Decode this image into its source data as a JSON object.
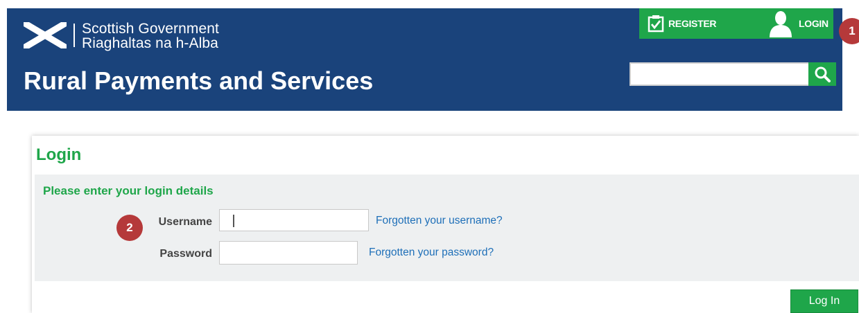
{
  "header": {
    "logo_line1": "Scottish Government",
    "logo_line2": "Riaghaltas na h-Alba",
    "site_title": "Rural Payments and Services",
    "nav": {
      "register_label": "REGISTER",
      "login_label": "LOGIN"
    },
    "search": {
      "value": "",
      "icon": "search-icon"
    }
  },
  "markers": {
    "marker1": "1",
    "marker2": "2"
  },
  "login_panel": {
    "title": "Login",
    "form_heading": "Please enter your login details",
    "username_label": "Username",
    "username_value": "",
    "password_label": "Password",
    "password_value": "",
    "forgot_username": "Forgotten your username?",
    "forgot_password": "Forgotten your password?",
    "login_button": "Log In"
  },
  "colors": {
    "header_bg": "#1a437b",
    "accent_green": "#1fa64a",
    "marker_red": "#b5393a",
    "link_blue": "#1e6fb8"
  }
}
